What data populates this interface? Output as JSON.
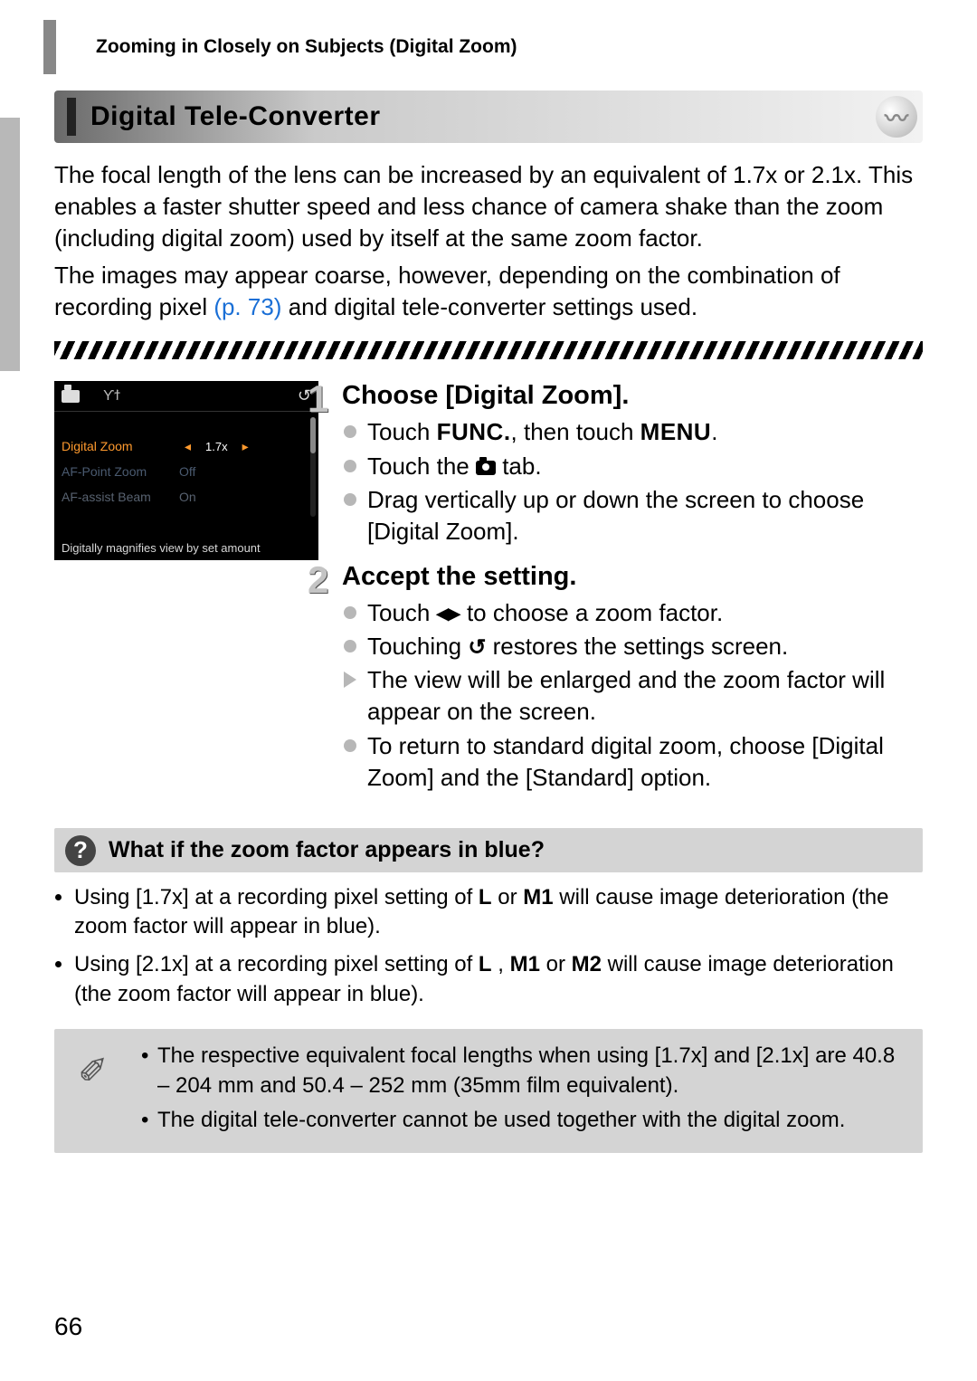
{
  "header": "Zooming in Closely on Subjects (Digital Zoom)",
  "section_title": "Digital Tele-Converter",
  "intro1": "The focal length of the lens can be increased by an equivalent of 1.7x or 2.1x. This enables a faster shutter speed and less chance of camera shake than the zoom (including digital zoom) used by itself at the same zoom factor.",
  "intro2a": "The images may appear coarse, however, depending on the combination of recording pixel ",
  "intro2_link": "(p. 73)",
  "intro2b": " and digital tele-converter settings used.",
  "camera_menu": {
    "row_active_label": "Digital Zoom",
    "row_active_value": "1.7x",
    "row2_label": "AF-Point Zoom",
    "row2_value": "Off",
    "row3_label": "AF-assist Beam",
    "row3_value": "On",
    "hint": "Digitally magnifies view by set amount"
  },
  "step1": {
    "num": "1",
    "title": "Choose [Digital Zoom].",
    "b1a": "Touch ",
    "b1_func": "FUNC.",
    "b1b": ", then touch ",
    "b1_menu": "MENU",
    "b1c": ".",
    "b2a": "Touch the ",
    "b2b": " tab.",
    "b3": "Drag vertically up or down the screen to choose [Digital Zoom]."
  },
  "step2": {
    "num": "2",
    "title": "Accept the setting.",
    "b1a": "Touch ",
    "b1b": " to choose a zoom factor.",
    "b2a": "Touching ",
    "b2b": " restores the settings screen.",
    "b3": "The view will be enlarged and the zoom factor will appear on the screen.",
    "b4": "To return to standard digital zoom, choose [Digital Zoom] and the [Standard] option."
  },
  "tip": {
    "title": "What if the zoom factor appears in blue?",
    "item1a": "Using [1.7x] at a recording pixel setting of  ",
    "L": "L",
    "or": "  or ",
    "M1": "M1",
    "item1b": " will cause image deterioration (the zoom factor will appear in blue).",
    "item2a": "Using [2.1x] at a recording pixel setting of  ",
    "comma": " , ",
    "or2": " or ",
    "M2": "M2",
    "item2b": "  will cause image deterioration (the zoom factor will appear in blue)."
  },
  "notes": {
    "n1": "The respective equivalent focal lengths when using [1.7x] and [2.1x] are 40.8 – 204 mm and 50.4 – 252 mm (35mm film equivalent).",
    "n2": "The digital tele-converter cannot be used together with the digital zoom."
  },
  "page_number": "66",
  "chart_data": {
    "type": "table",
    "title": "Digital Zoom menu (camera screenshot)",
    "rows": [
      {
        "setting": "Digital Zoom",
        "value": "1.7x",
        "highlighted": true
      },
      {
        "setting": "AF-Point Zoom",
        "value": "Off",
        "highlighted": false
      },
      {
        "setting": "AF-assist Beam",
        "value": "On",
        "highlighted": false
      }
    ],
    "caption": "Digitally magnifies view by set amount"
  }
}
